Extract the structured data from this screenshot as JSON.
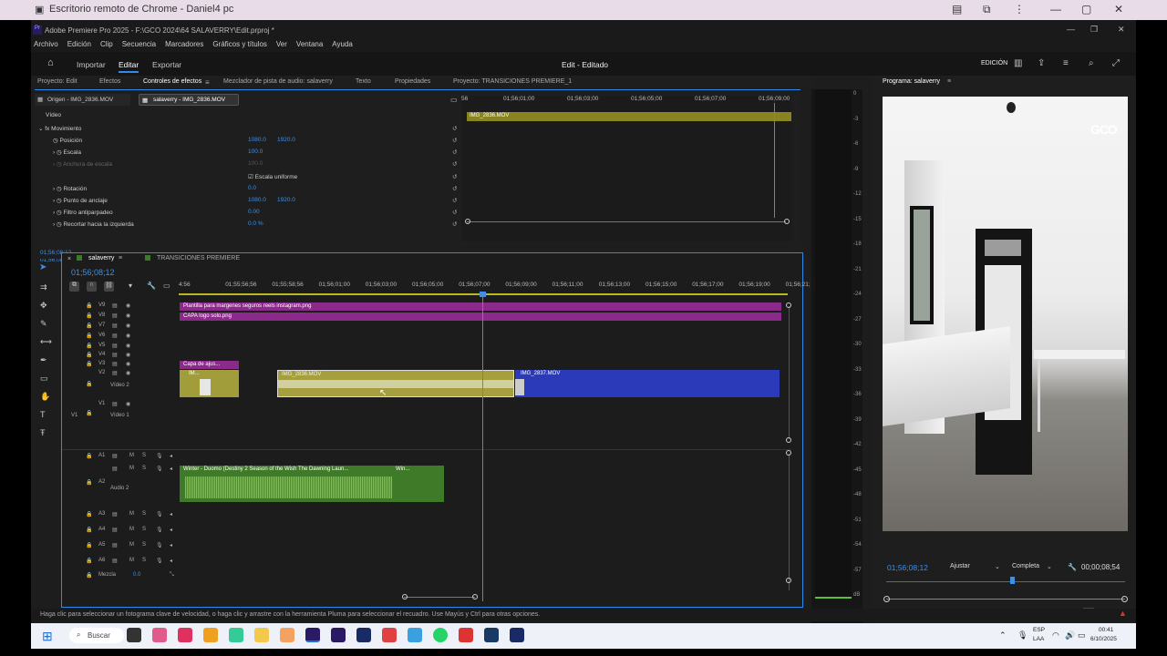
{
  "chrome_rd": {
    "title": "Escritorio remoto de Chrome - Daniel4 pc"
  },
  "premiere": {
    "title": "Adobe Premiere Pro 2025 - F:\\GCO 2024\\64 SALAVERRY\\Edit.prproj *",
    "menu": [
      "Archivo",
      "Edición",
      "Clip",
      "Secuencia",
      "Marcadores",
      "Gráficos y títulos",
      "Ver",
      "Ventana",
      "Ayuda"
    ],
    "workspace": {
      "tabs": [
        "Importar",
        "Editar",
        "Exportar"
      ],
      "center": "Edit - Editado",
      "right_label": "EDICIÓN"
    },
    "panel_tabs": [
      "Proyecto: Edit",
      "Efectos",
      "Controles de efectos",
      "Mezclador de pista de audio: salaverry",
      "Texto",
      "Propiedades",
      "Proyecto: TRANSICIONES PREMIERE_1"
    ],
    "program_tab": "Programa: salaverry",
    "effect_controls": {
      "source_tabs": [
        "Origen - IMG_2836.MOV",
        "salaverry - IMG_2836.MOV"
      ],
      "section": "Vídeo",
      "rows": [
        {
          "label": "Movimiento",
          "v1": "",
          "v2": ""
        },
        {
          "label": "Posición",
          "v1": "1080.0",
          "v2": "1920.0"
        },
        {
          "label": "Escala",
          "v1": "100.0",
          "v2": ""
        },
        {
          "label": "Anchura de escala",
          "v1": "100.0",
          "v2": ""
        },
        {
          "label": "Escala uniforme",
          "v1": "",
          "v2": ""
        },
        {
          "label": "Rotación",
          "v1": "0.0",
          "v2": ""
        },
        {
          "label": "Punto de anclaje",
          "v1": "1080.0",
          "v2": "1920.0"
        },
        {
          "label": "Filtro antiparpadeo",
          "v1": "0.00",
          "v2": ""
        },
        {
          "label": "Recortar hacia la izquierda",
          "v1": "0.0 %",
          "v2": ""
        }
      ],
      "mini_ruler": [
        "56",
        "01;56;01;00",
        "01;56;03;00",
        "01;56;05;00",
        "01;56;07;00",
        "01;56;09;00"
      ],
      "mini_clip": "IMG_2836.MOV",
      "timecode": "01;56;08;12"
    },
    "timeline": {
      "tabs": [
        "salaverry",
        "TRANSICIONES PREMIERE"
      ],
      "timecode": "01;56;08;12",
      "ruler": [
        "4:56",
        "01;55;56;56",
        "01;55;58;56",
        "01;56;01;00",
        "01;56;03;00",
        "01;56;05;00",
        "01;56;07;00",
        "01;56;09;00",
        "01;56;11;00",
        "01;56;13;00",
        "01;56;15;00",
        "01;56;17;00",
        "01;56;19;00",
        "01;56;21;"
      ],
      "video_tracks": [
        "V9",
        "V8",
        "V7",
        "V6",
        "V5",
        "V4",
        "V3",
        "V2",
        "V1"
      ],
      "v2_name": "Vídeo 2",
      "v1_name": "Vídeo 1",
      "audio_tracks": [
        "A1",
        "A2",
        "A3",
        "A4",
        "A5",
        "A6"
      ],
      "a2_name": "Audio 2",
      "mix_label": "Mezcla",
      "mix_value": "0.0",
      "clips": {
        "v9": "Plantilla para margenes seguros reels instagram.png",
        "v8": "CAPA logo solo.png",
        "v3": "Capa de ajus...",
        "v2a": "IM...",
        "v2b": "IMG_2836.MOV",
        "v2c": "IMG_2837.MOV",
        "a2a": "Winter - Duomo (Destiny 2 Season of the Wish The Dawning Laun...",
        "a2b": "Win..."
      }
    },
    "meter_scale": [
      "0",
      "-3",
      "-6",
      "-9",
      "-12",
      "-15",
      "-18",
      "-21",
      "-24",
      "-27",
      "-30",
      "-33",
      "-36",
      "-39",
      "-42",
      "-45",
      "-48",
      "-51",
      "-54",
      "-57",
      "dB"
    ],
    "program": {
      "overlay_logo": "GCO",
      "timecode": "01;56;08;12",
      "fit": "Ajustar",
      "quality": "Completa",
      "duration": "00;00;08;54"
    },
    "status": "Haga clic para seleccionar un fotograma clave de velocidad, o haga clic y arrastre con la herramienta Pluma para seleccionar el recuadro. Use Mayús y Ctrl para otras opciones."
  },
  "taskbar": {
    "search": "Buscar",
    "lang1": "ESP",
    "lang2": "LAA",
    "time": "00:41",
    "date": "6/10/2025"
  }
}
